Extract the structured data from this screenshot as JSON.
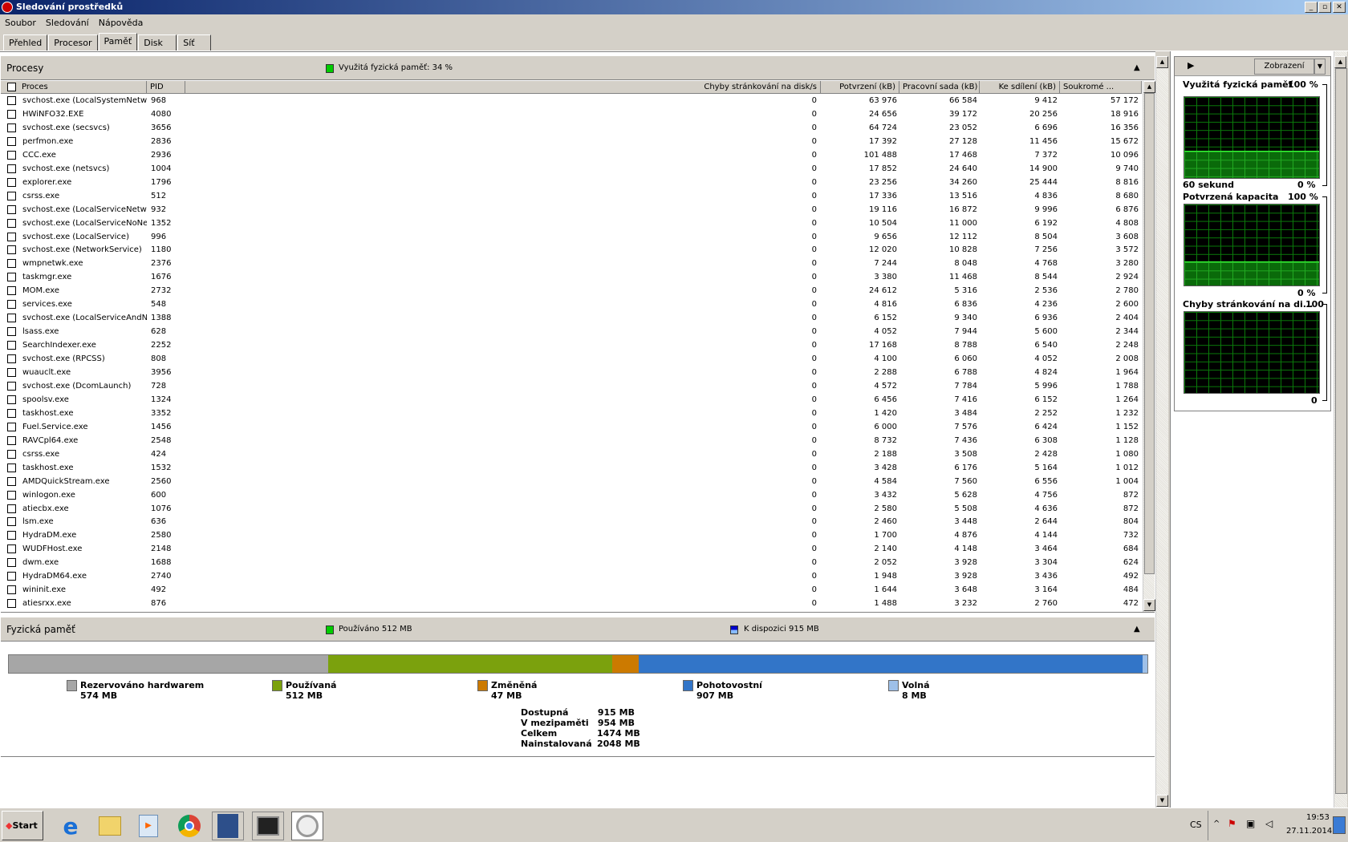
{
  "window": {
    "title": "Sledování prostředků",
    "min": "_",
    "max": "▫",
    "close": "✕"
  },
  "menu": [
    "Soubor",
    "Sledování",
    "Nápověda"
  ],
  "tabs": [
    "Přehled",
    "Procesor",
    "Paměť",
    "Disk",
    "Síť"
  ],
  "active_tab": "Paměť",
  "processes": {
    "title": "Procesy",
    "legend": "Využitá fyzická paměť: 34 %",
    "columns": [
      "Proces",
      "PID",
      "Chyby stránkování na disk/s",
      "Potvrzení (kB)",
      "Pracovní sada (kB)",
      "Ke sdílení (kB)",
      "Soukromé ..."
    ],
    "rows": [
      [
        "svchost.exe (LocalSystemNetwo...",
        "968",
        "0",
        "63 976",
        "66 584",
        "9 412",
        "57 172"
      ],
      [
        "HWiNFO32.EXE",
        "4080",
        "0",
        "24 656",
        "39 172",
        "20 256",
        "18 916"
      ],
      [
        "svchost.exe (secsvcs)",
        "3656",
        "0",
        "64 724",
        "23 052",
        "6 696",
        "16 356"
      ],
      [
        "perfmon.exe",
        "2836",
        "0",
        "17 392",
        "27 128",
        "11 456",
        "15 672"
      ],
      [
        "CCC.exe",
        "2936",
        "0",
        "101 488",
        "17 468",
        "7 372",
        "10 096"
      ],
      [
        "svchost.exe (netsvcs)",
        "1004",
        "0",
        "17 852",
        "24 640",
        "14 900",
        "9 740"
      ],
      [
        "explorer.exe",
        "1796",
        "0",
        "23 256",
        "34 260",
        "25 444",
        "8 816"
      ],
      [
        "csrss.exe",
        "512",
        "0",
        "17 336",
        "13 516",
        "4 836",
        "8 680"
      ],
      [
        "svchost.exe (LocalServiceNetwo...",
        "932",
        "0",
        "19 116",
        "16 872",
        "9 996",
        "6 876"
      ],
      [
        "svchost.exe (LocalServiceNoNet...",
        "1352",
        "0",
        "10 504",
        "11 000",
        "6 192",
        "4 808"
      ],
      [
        "svchost.exe (LocalService)",
        "996",
        "0",
        "9 656",
        "12 112",
        "8 504",
        "3 608"
      ],
      [
        "svchost.exe (NetworkService)",
        "1180",
        "0",
        "12 020",
        "10 828",
        "7 256",
        "3 572"
      ],
      [
        "wmpnetwk.exe",
        "2376",
        "0",
        "7 244",
        "8 048",
        "4 768",
        "3 280"
      ],
      [
        "taskmgr.exe",
        "1676",
        "0",
        "3 380",
        "11 468",
        "8 544",
        "2 924"
      ],
      [
        "MOM.exe",
        "2732",
        "0",
        "24 612",
        "5 316",
        "2 536",
        "2 780"
      ],
      [
        "services.exe",
        "548",
        "0",
        "4 816",
        "6 836",
        "4 236",
        "2 600"
      ],
      [
        "svchost.exe (LocalServiceAndN...",
        "1388",
        "0",
        "6 152",
        "9 340",
        "6 936",
        "2 404"
      ],
      [
        "lsass.exe",
        "628",
        "0",
        "4 052",
        "7 944",
        "5 600",
        "2 344"
      ],
      [
        "SearchIndexer.exe",
        "2252",
        "0",
        "17 168",
        "8 788",
        "6 540",
        "2 248"
      ],
      [
        "svchost.exe (RPCSS)",
        "808",
        "0",
        "4 100",
        "6 060",
        "4 052",
        "2 008"
      ],
      [
        "wuauclt.exe",
        "3956",
        "0",
        "2 288",
        "6 788",
        "4 824",
        "1 964"
      ],
      [
        "svchost.exe (DcomLaunch)",
        "728",
        "0",
        "4 572",
        "7 784",
        "5 996",
        "1 788"
      ],
      [
        "spoolsv.exe",
        "1324",
        "0",
        "6 456",
        "7 416",
        "6 152",
        "1 264"
      ],
      [
        "taskhost.exe",
        "3352",
        "0",
        "1 420",
        "3 484",
        "2 252",
        "1 232"
      ],
      [
        "Fuel.Service.exe",
        "1456",
        "0",
        "6 000",
        "7 576",
        "6 424",
        "1 152"
      ],
      [
        "RAVCpl64.exe",
        "2548",
        "0",
        "8 732",
        "7 436",
        "6 308",
        "1 128"
      ],
      [
        "csrss.exe",
        "424",
        "0",
        "2 188",
        "3 508",
        "2 428",
        "1 080"
      ],
      [
        "taskhost.exe",
        "1532",
        "0",
        "3 428",
        "6 176",
        "5 164",
        "1 012"
      ],
      [
        "AMDQuickStream.exe",
        "2560",
        "0",
        "4 584",
        "7 560",
        "6 556",
        "1 004"
      ],
      [
        "winlogon.exe",
        "600",
        "0",
        "3 432",
        "5 628",
        "4 756",
        "872"
      ],
      [
        "atiecbx.exe",
        "1076",
        "0",
        "2 580",
        "5 508",
        "4 636",
        "872"
      ],
      [
        "lsm.exe",
        "636",
        "0",
        "2 460",
        "3 448",
        "2 644",
        "804"
      ],
      [
        "HydraDM.exe",
        "2580",
        "0",
        "1 700",
        "4 876",
        "4 144",
        "732"
      ],
      [
        "WUDFHost.exe",
        "2148",
        "0",
        "2 140",
        "4 148",
        "3 464",
        "684"
      ],
      [
        "dwm.exe",
        "1688",
        "0",
        "2 052",
        "3 928",
        "3 304",
        "624"
      ],
      [
        "HydraDM64.exe",
        "2740",
        "0",
        "1 948",
        "3 928",
        "3 436",
        "492"
      ],
      [
        "wininit.exe",
        "492",
        "0",
        "1 644",
        "3 648",
        "3 164",
        "484"
      ],
      [
        "atiesrxx.exe",
        "876",
        "0",
        "1 488",
        "3 232",
        "2 760",
        "472"
      ]
    ]
  },
  "physical": {
    "title": "Fyzická paměť",
    "legend_used": "Používáno 512 MB",
    "legend_available": "K dispozici 915 MB",
    "segments": [
      {
        "label": "Rezervováno hardwarem",
        "value": "574 MB",
        "mb": 574,
        "color": "#a6a6a6"
      },
      {
        "label": "Používaná",
        "value": "512 MB",
        "mb": 512,
        "color": "#7ba10d"
      },
      {
        "label": "Změněná",
        "value": "47 MB",
        "mb": 47,
        "color": "#cc7a00"
      },
      {
        "label": "Pohotovostní",
        "value": "907 MB",
        "mb": 907,
        "color": "#3275c8"
      },
      {
        "label": "Volná",
        "value": "8 MB",
        "mb": 8,
        "color": "#9ec0e8"
      }
    ],
    "summary": [
      [
        "Dostupná",
        "915 MB"
      ],
      [
        "V mezipaměti",
        "954 MB"
      ],
      [
        "Celkem",
        "1474 MB"
      ],
      [
        "Nainstalovaná",
        "2048 MB"
      ]
    ]
  },
  "graphs": {
    "view_button": "Zobrazení",
    "g1": {
      "title": "Využitá fyzická paměť",
      "max": "100 %",
      "min": "0 %",
      "time": "60 sekund",
      "level_pct": 34
    },
    "g2": {
      "title": "Potvrzená kapacita",
      "max": "100 %",
      "min": "0 %",
      "level_pct": 30
    },
    "g3": {
      "title": "Chyby stránkování na di...",
      "max": "100",
      "min": "0",
      "level_pct": 0
    }
  },
  "taskbar": {
    "start": "Start",
    "lang": "CS",
    "time": "19:53",
    "date": "27.11.2014"
  }
}
